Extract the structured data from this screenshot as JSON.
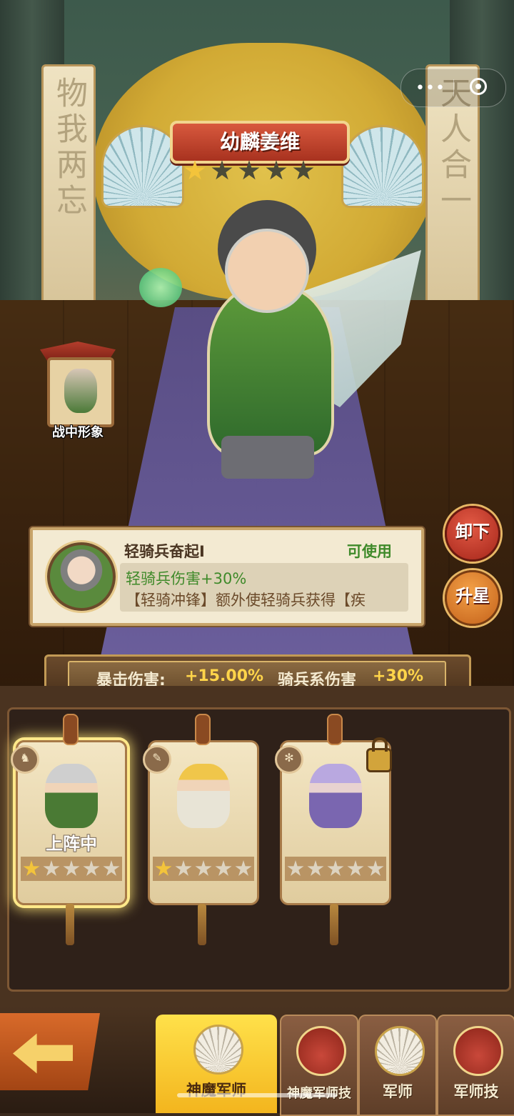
{
  "hero": {
    "name": "幼麟姜维",
    "stars_total": 5,
    "stars_filled": 1
  },
  "scene": {
    "banner_left": "物我两忘",
    "banner_right": "天人合一"
  },
  "mini_program_capsule": {
    "more_icon": "more-dots-icon",
    "close_icon": "target-circle-icon"
  },
  "battle_image": {
    "label": "战中形象"
  },
  "side_buttons": {
    "unload": "卸下",
    "upgrade_star": "升星"
  },
  "skill": {
    "name": "轻骑兵奋起Ⅰ",
    "status": "可使用",
    "line1": "轻骑兵伤害+30%",
    "line2": "【轻骑冲锋】额外使轻骑兵获得【疾"
  },
  "stats": {
    "crit_label": "暴击伤害:",
    "crit_value": "+15.00%",
    "cav_label": "骑兵系伤害",
    "cav_value": "+30%"
  },
  "cards": [
    {
      "badge_icon": "horse-icon",
      "status": "上阵中",
      "stars_filled": 1,
      "locked": false,
      "selected": true
    },
    {
      "badge_icon": "feather-icon",
      "status": "",
      "stars_filled": 1,
      "locked": false,
      "selected": false
    },
    {
      "badge_icon": "snowflake-icon",
      "status": "",
      "stars_filled": 0,
      "locked": true,
      "selected": false
    }
  ],
  "tabs": [
    {
      "label": "神魔军师",
      "icon": "feather-fan-icon",
      "active": true
    },
    {
      "label": "神魔军师技",
      "icon": "pouch-icon",
      "active": false
    },
    {
      "label": "军师",
      "icon": "feather-fan-icon",
      "active": false
    },
    {
      "label": "军师技",
      "icon": "pouch-icon",
      "active": false
    }
  ],
  "colors": {
    "title_red": "#a8321f",
    "green_text": "#3f8a2a",
    "gold_value": "#ffd54a",
    "active_tab": "#ffe14a"
  }
}
